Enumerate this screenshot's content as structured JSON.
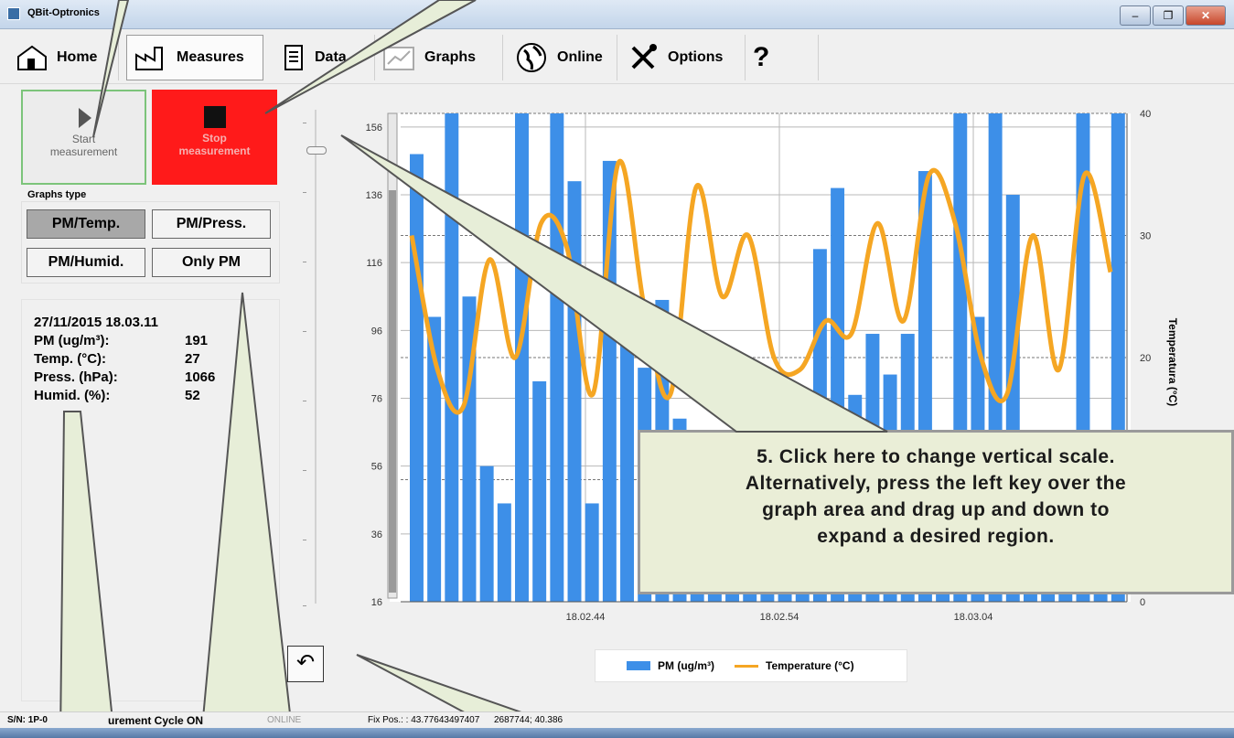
{
  "window": {
    "title": "QBit-Optronics"
  },
  "toolbar": {
    "home": "Home",
    "measures": "Measures",
    "data": "Data",
    "graphs": "Graphs",
    "online": "Online",
    "options": "Options",
    "help": "?"
  },
  "controls": {
    "start_line1": "Start",
    "start_line2": "measurement",
    "stop_line1": "Stop",
    "stop_line2": "measurement"
  },
  "graphs_type": {
    "label": "Graphs type",
    "options": [
      "PM/Temp.",
      "PM/Press.",
      "PM/Humid.",
      "Only PM"
    ],
    "selected": "PM/Temp."
  },
  "info": {
    "timestamp": "27/11/2015 18.03.11",
    "rows": [
      {
        "label": "PM (ug/m³):",
        "value": "191"
      },
      {
        "label": "Temp. (°C):",
        "value": "27"
      },
      {
        "label": "Press. (hPa):",
        "value": "1066"
      },
      {
        "label": "Humid. (%):",
        "value": "52"
      }
    ]
  },
  "callout": {
    "lines": [
      "5. Click here to change vertical scale.",
      "Alternatively, press the left key over the",
      "graph area and drag up and down to",
      "expand a desired region."
    ]
  },
  "statusbar": {
    "serial": "S/N: 1P-0",
    "cycle": "urement Cycle ON",
    "online": "ONLINE",
    "fix": "Fix Pos.: : 43.77643497407",
    "fix_tail": "2687744; 40.386"
  },
  "chart_data": {
    "type": "bar",
    "x_ticks": [
      "18.02.44",
      "18.02.54",
      "18.03.04"
    ],
    "y_left_ticks": [
      16,
      36,
      56,
      76,
      96,
      116,
      136,
      156
    ],
    "y_right_ticks": [
      0,
      10,
      20,
      30,
      40
    ],
    "ylabel_right": "Temperatura (°C)",
    "ylim_left": [
      16,
      160
    ],
    "ylim_right": [
      0,
      40
    ],
    "grid": true,
    "legend_position": "bottom",
    "series": [
      {
        "name": "PM (ug/m³)",
        "color": "#3d8fe8",
        "values": [
          148,
          100,
          160,
          106,
          56,
          45,
          160,
          81,
          160,
          140,
          45,
          146,
          98,
          85,
          105,
          70,
          60,
          50,
          40,
          30,
          25,
          80,
          70,
          120,
          138,
          77,
          95,
          83,
          95,
          143,
          60,
          160,
          100,
          160,
          136,
          60,
          40,
          20,
          160,
          40,
          160
        ]
      },
      {
        "name": "Temperature (°C)",
        "color": "#f5a623",
        "values": [
          30,
          19,
          16,
          28,
          20,
          31,
          29,
          17,
          36,
          24,
          17,
          34,
          25,
          30,
          20,
          19,
          23,
          22,
          31,
          23,
          35,
          31,
          20,
          17,
          30,
          19,
          35,
          27
        ]
      }
    ]
  }
}
